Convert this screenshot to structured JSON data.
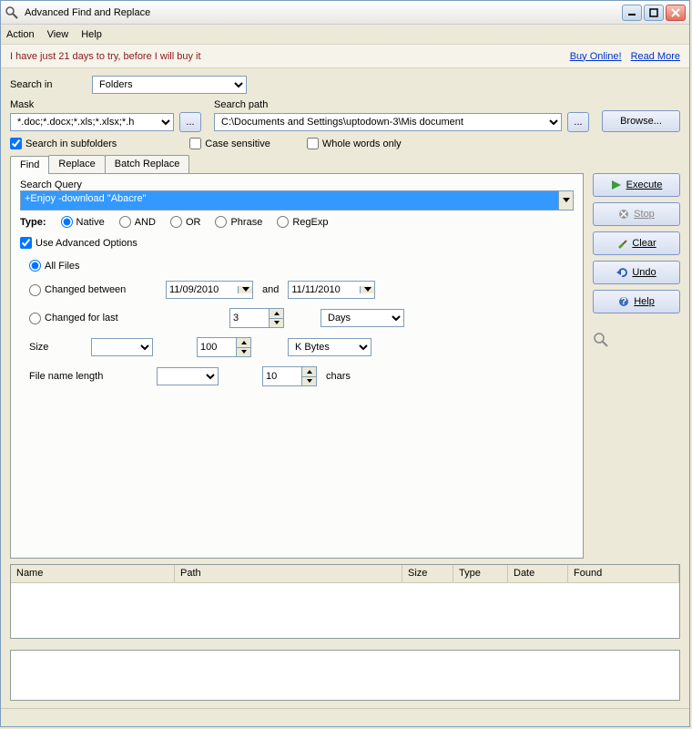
{
  "window": {
    "title": "Advanced Find and Replace"
  },
  "menu": {
    "action": "Action",
    "view": "View",
    "help": "Help"
  },
  "trial": {
    "msg": "I have just 21 days to try, before I will buy it",
    "buy": "Buy Online!",
    "read": "Read More"
  },
  "search_in": {
    "label": "Search in",
    "value": "Folders"
  },
  "mask": {
    "label": "Mask",
    "value": "*.doc;*.docx;*.xls;*.xlsx;*.h"
  },
  "mask_btn": "...",
  "path": {
    "label": "Search path",
    "value": "C:\\Documents and Settings\\uptodown-3\\Mis document"
  },
  "path_btn": "...",
  "browse": "Browse...",
  "opts": {
    "subfolders": "Search in subfolders",
    "case": "Case sensitive",
    "whole": "Whole words only"
  },
  "tabs": {
    "find": "Find",
    "replace": "Replace",
    "batch": "Batch Replace"
  },
  "query": {
    "label": "Search Query",
    "value": "+Enjoy -download \"Abacre\""
  },
  "type": {
    "label": "Type:",
    "native": "Native",
    "and": "AND",
    "or": "OR",
    "phrase": "Phrase",
    "regexp": "RegExp"
  },
  "adv": {
    "label": "Use Advanced Options"
  },
  "filter": {
    "all": "All Files",
    "between": "Changed between",
    "date_from": "11/09/2010",
    "and": "and",
    "date_to": "11/11/2010",
    "last": "Changed for last",
    "last_n": "3",
    "last_unit": "Days",
    "size": "Size",
    "size_op": "",
    "size_n": "100",
    "size_unit": "K Bytes",
    "fname": "File name length",
    "fname_op": "",
    "fname_n": "10",
    "fname_suffix": "chars"
  },
  "actions": {
    "execute": "Execute",
    "stop": "Stop",
    "clear": "Clear",
    "undo": "Undo",
    "help": "Help"
  },
  "columns": {
    "name": "Name",
    "path": "Path",
    "size": "Size",
    "type": "Type",
    "date": "Date",
    "found": "Found"
  }
}
